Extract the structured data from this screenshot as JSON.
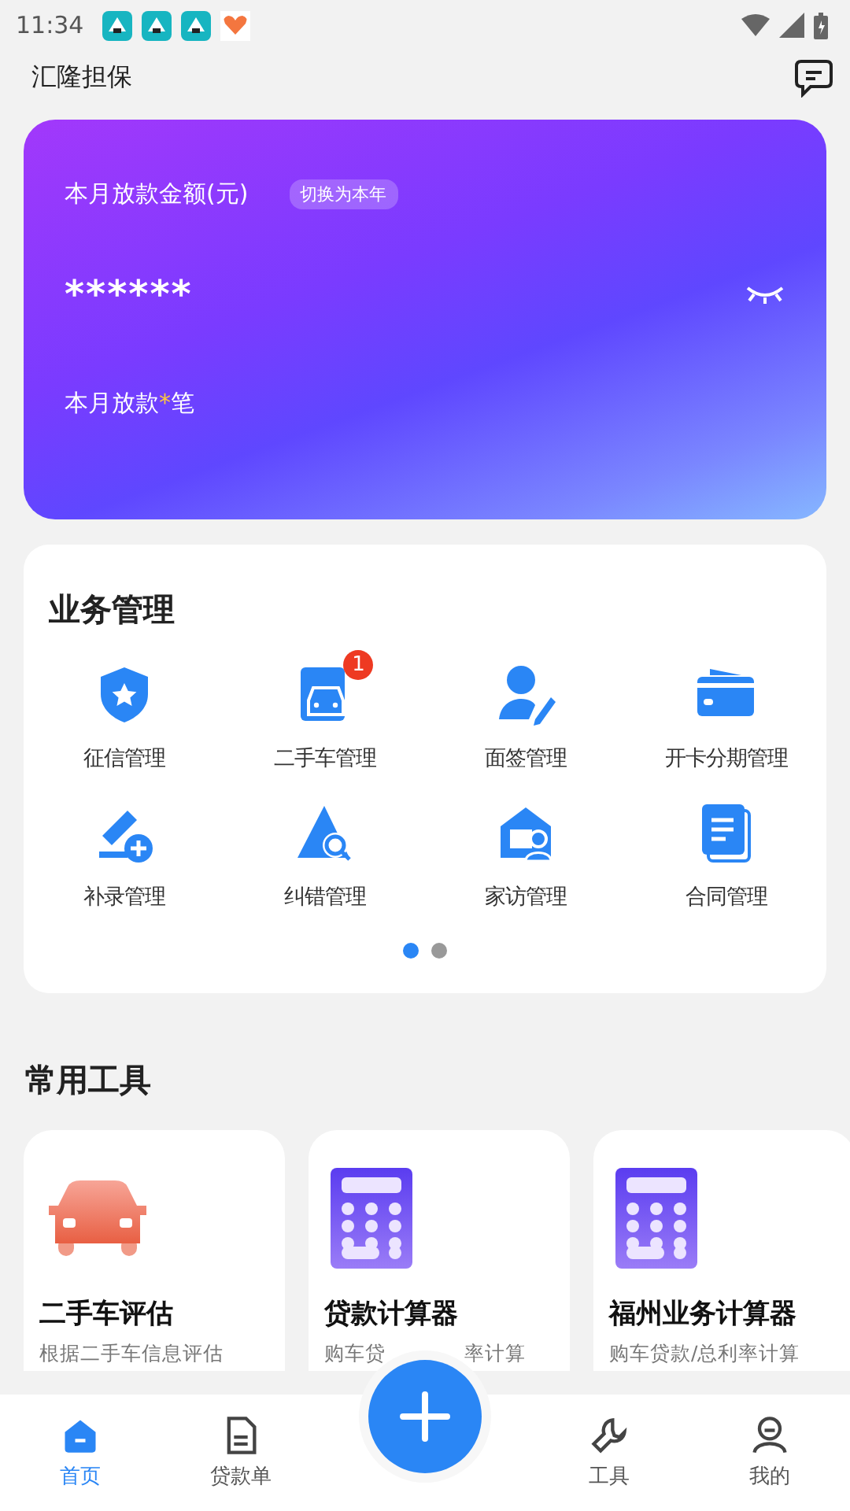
{
  "status_bar": {
    "time": "11:34"
  },
  "header": {
    "title": "汇隆担保"
  },
  "summary_card": {
    "label": "本月放款金额(元)",
    "toggle": "切换为本年",
    "amount": "******",
    "count_prefix": "本月放款",
    "count_value": "*",
    "count_suffix": "笔"
  },
  "business": {
    "title": "业务管理",
    "items": [
      {
        "label": "征信管理"
      },
      {
        "label": "二手车管理",
        "badge": "1"
      },
      {
        "label": "面签管理"
      },
      {
        "label": "开卡分期管理"
      },
      {
        "label": "补录管理"
      },
      {
        "label": "纠错管理"
      },
      {
        "label": "家访管理"
      },
      {
        "label": "合同管理"
      }
    ],
    "pages": [
      {
        "selected": true
      },
      {
        "selected": false
      }
    ]
  },
  "tools": {
    "title": "常用工具",
    "cards": [
      {
        "title": "二手车评估",
        "subtitle": "根据二手车信息评估"
      },
      {
        "title": "贷款计算器",
        "subtitle": "购车贷",
        "subtitle_end": "率计算"
      },
      {
        "title": "福州业务计算器",
        "subtitle": "购车贷款/总利率计算"
      }
    ]
  },
  "nav": {
    "items": [
      {
        "label": "首页",
        "selected": true
      },
      {
        "label": "贷款单",
        "selected": false
      },
      {
        "label": "工具",
        "selected": false
      },
      {
        "label": "我的",
        "selected": false
      }
    ]
  }
}
